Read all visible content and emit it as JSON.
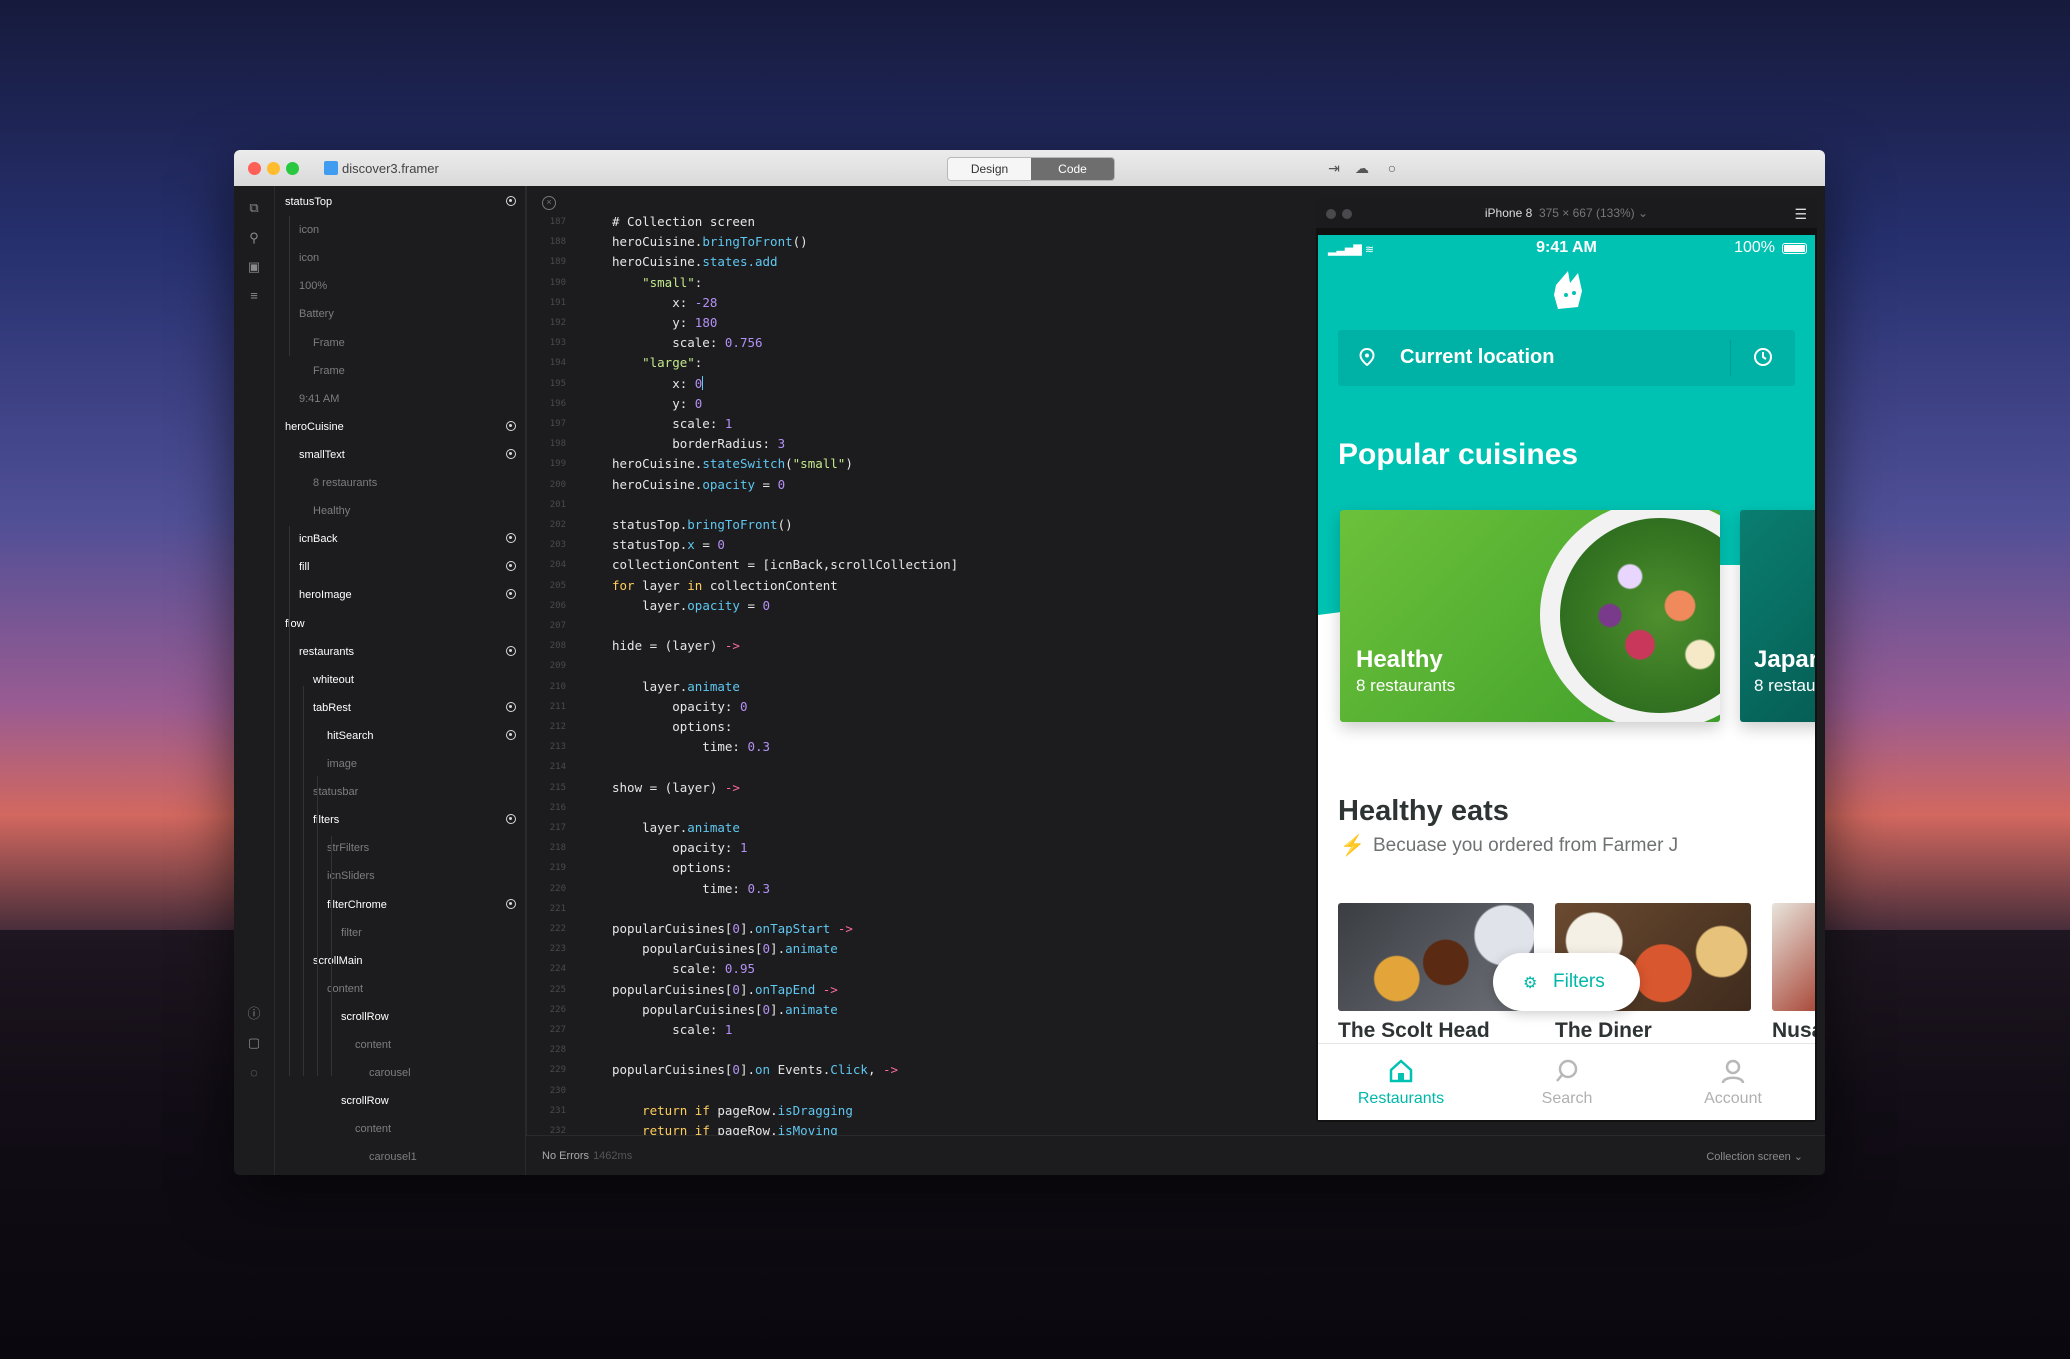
{
  "window": {
    "project_name": "discover3.framer",
    "mode_tabs": [
      "Design",
      "Code"
    ],
    "active_mode": "Code"
  },
  "layers": [
    {
      "name": "statusTop",
      "depth": 0,
      "bold": true,
      "dot": true
    },
    {
      "name": "icon",
      "depth": 1,
      "bold": false,
      "dot": false
    },
    {
      "name": "icon",
      "depth": 1,
      "bold": false,
      "dot": false
    },
    {
      "name": "100%",
      "depth": 1,
      "bold": false,
      "dot": false
    },
    {
      "name": "Battery",
      "depth": 1,
      "bold": false,
      "dot": false
    },
    {
      "name": "Frame",
      "depth": 2,
      "bold": false,
      "dot": false
    },
    {
      "name": "Frame",
      "depth": 2,
      "bold": false,
      "dot": false
    },
    {
      "name": "9:41 AM",
      "depth": 1,
      "bold": false,
      "dot": false
    },
    {
      "name": "heroCuisine",
      "depth": 0,
      "bold": true,
      "dot": true
    },
    {
      "name": "smallText",
      "depth": 1,
      "bold": true,
      "dot": true
    },
    {
      "name": "8 restaurants",
      "depth": 2,
      "bold": false,
      "dot": false
    },
    {
      "name": "Healthy",
      "depth": 2,
      "bold": false,
      "dot": false
    },
    {
      "name": "icnBack",
      "depth": 1,
      "bold": true,
      "dot": true
    },
    {
      "name": "fill",
      "depth": 1,
      "bold": true,
      "dot": true
    },
    {
      "name": "heroImage",
      "depth": 1,
      "bold": true,
      "dot": true
    },
    {
      "name": "flow",
      "depth": 0,
      "bold": true,
      "dot": false
    },
    {
      "name": "restaurants",
      "depth": 1,
      "bold": true,
      "dot": true
    },
    {
      "name": "whiteout",
      "depth": 2,
      "bold": true,
      "dot": false
    },
    {
      "name": "tabRest",
      "depth": 2,
      "bold": true,
      "dot": true
    },
    {
      "name": "hitSearch",
      "depth": 3,
      "bold": true,
      "dot": true
    },
    {
      "name": "image",
      "depth": 3,
      "bold": false,
      "dot": false
    },
    {
      "name": "statusbar",
      "depth": 2,
      "bold": false,
      "dot": false
    },
    {
      "name": "filters",
      "depth": 2,
      "bold": true,
      "dot": true
    },
    {
      "name": "strFilters",
      "depth": 3,
      "bold": false,
      "dot": false
    },
    {
      "name": "icnSliders",
      "depth": 3,
      "bold": false,
      "dot": false
    },
    {
      "name": "filterChrome",
      "depth": 3,
      "bold": true,
      "dot": true
    },
    {
      "name": "filter",
      "depth": 4,
      "bold": false,
      "dot": false
    },
    {
      "name": "scrollMain",
      "depth": 2,
      "bold": true,
      "dot": false
    },
    {
      "name": "content",
      "depth": 3,
      "bold": false,
      "dot": false
    },
    {
      "name": "scrollRow",
      "depth": 4,
      "bold": true,
      "dot": false
    },
    {
      "name": "content",
      "depth": 5,
      "bold": false,
      "dot": false
    },
    {
      "name": "carousel",
      "depth": 6,
      "bold": false,
      "dot": false
    },
    {
      "name": "scrollRow",
      "depth": 4,
      "bold": true,
      "dot": false
    },
    {
      "name": "content",
      "depth": 5,
      "bold": false,
      "dot": false
    },
    {
      "name": "carousel1",
      "depth": 6,
      "bold": false,
      "dot": false
    }
  ],
  "code": {
    "header_comment": "# Collection screen",
    "lines": [
      {
        "n": "187",
        "t": []
      },
      {
        "n": "188",
        "t": [
          [
            "heroCuisine.",
            ""
          ],
          [
            "bringToFront",
            "prop"
          ],
          [
            "()",
            ""
          ]
        ]
      },
      {
        "n": "189",
        "t": [
          [
            "heroCuisine.",
            ""
          ],
          [
            "states.add",
            "prop"
          ]
        ]
      },
      {
        "n": "190",
        "t": [
          [
            "    ",
            ""
          ],
          [
            "\"small\"",
            "str"
          ],
          [
            ":",
            ""
          ]
        ]
      },
      {
        "n": "191",
        "t": [
          [
            "        x: ",
            ""
          ],
          [
            "-28",
            "num"
          ]
        ]
      },
      {
        "n": "192",
        "t": [
          [
            "        y: ",
            ""
          ],
          [
            "180",
            "num"
          ]
        ]
      },
      {
        "n": "193",
        "t": [
          [
            "        scale: ",
            ""
          ],
          [
            "0.756",
            "num"
          ]
        ]
      },
      {
        "n": "194",
        "t": [
          [
            "    ",
            ""
          ],
          [
            "\"large\"",
            "str"
          ],
          [
            ":",
            ""
          ]
        ]
      },
      {
        "n": "195",
        "t": [
          [
            "        x: ",
            ""
          ],
          [
            "0",
            "num"
          ],
          [
            "|",
            "cursor"
          ]
        ]
      },
      {
        "n": "196",
        "t": [
          [
            "        y: ",
            ""
          ],
          [
            "0",
            "num"
          ]
        ]
      },
      {
        "n": "197",
        "t": [
          [
            "        scale: ",
            ""
          ],
          [
            "1",
            "num"
          ]
        ]
      },
      {
        "n": "198",
        "t": [
          [
            "        borderRadius: ",
            ""
          ],
          [
            "3",
            "num"
          ]
        ]
      },
      {
        "n": "199",
        "t": [
          [
            "heroCuisine.",
            ""
          ],
          [
            "stateSwitch",
            "prop"
          ],
          [
            "(",
            ""
          ],
          [
            "\"small\"",
            "str"
          ],
          [
            ")",
            ""
          ]
        ]
      },
      {
        "n": "200",
        "t": [
          [
            "heroCuisine.",
            ""
          ],
          [
            "opacity",
            "prop"
          ],
          [
            " = ",
            ""
          ],
          [
            "0",
            "num"
          ]
        ]
      },
      {
        "n": "201",
        "t": []
      },
      {
        "n": "202",
        "t": [
          [
            "statusTop.",
            ""
          ],
          [
            "bringToFront",
            "prop"
          ],
          [
            "()",
            ""
          ]
        ]
      },
      {
        "n": "203",
        "t": [
          [
            "statusTop.",
            ""
          ],
          [
            "x",
            "prop"
          ],
          [
            " = ",
            ""
          ],
          [
            "0",
            "num"
          ]
        ]
      },
      {
        "n": "204",
        "t": [
          [
            "collectionContent = [icnBack,scrollCollection]",
            ""
          ]
        ]
      },
      {
        "n": "205",
        "t": [
          [
            "for",
            "kw"
          ],
          [
            " layer ",
            ""
          ],
          [
            "in",
            "kw"
          ],
          [
            " collectionContent",
            ""
          ]
        ]
      },
      {
        "n": "206",
        "t": [
          [
            "    layer.",
            ""
          ],
          [
            "opacity",
            "prop"
          ],
          [
            " = ",
            ""
          ],
          [
            "0",
            "num"
          ]
        ]
      },
      {
        "n": "207",
        "t": []
      },
      {
        "n": "208",
        "t": [
          [
            "hide = (layer) ",
            ""
          ],
          [
            "->",
            "arrow"
          ]
        ]
      },
      {
        "n": "209",
        "t": []
      },
      {
        "n": "210",
        "t": [
          [
            "    layer.",
            ""
          ],
          [
            "animate",
            "prop"
          ]
        ]
      },
      {
        "n": "211",
        "t": [
          [
            "        opacity: ",
            ""
          ],
          [
            "0",
            "num"
          ]
        ]
      },
      {
        "n": "212",
        "t": [
          [
            "        options:",
            ""
          ]
        ]
      },
      {
        "n": "213",
        "t": [
          [
            "            time: ",
            ""
          ],
          [
            "0.3",
            "num"
          ]
        ]
      },
      {
        "n": "214",
        "t": []
      },
      {
        "n": "215",
        "t": [
          [
            "show = (layer) ",
            ""
          ],
          [
            "->",
            "arrow"
          ]
        ]
      },
      {
        "n": "216",
        "t": []
      },
      {
        "n": "217",
        "t": [
          [
            "    layer.",
            ""
          ],
          [
            "animate",
            "prop"
          ]
        ]
      },
      {
        "n": "218",
        "t": [
          [
            "        opacity: ",
            ""
          ],
          [
            "1",
            "num"
          ]
        ]
      },
      {
        "n": "219",
        "t": [
          [
            "        options:",
            ""
          ]
        ]
      },
      {
        "n": "220",
        "t": [
          [
            "            time: ",
            ""
          ],
          [
            "0.3",
            "num"
          ]
        ]
      },
      {
        "n": "221",
        "t": []
      },
      {
        "n": "222",
        "t": [
          [
            "popularCuisines[",
            ""
          ],
          [
            "0",
            "num"
          ],
          [
            "].",
            ""
          ],
          [
            "onTapStart",
            "prop"
          ],
          [
            " ",
            ""
          ],
          [
            "->",
            "arrow"
          ]
        ]
      },
      {
        "n": "223",
        "t": [
          [
            "    popularCuisines[",
            ""
          ],
          [
            "0",
            "num"
          ],
          [
            "].",
            ""
          ],
          [
            "animate",
            "prop"
          ]
        ]
      },
      {
        "n": "224",
        "t": [
          [
            "        scale: ",
            ""
          ],
          [
            "0.95",
            "num"
          ]
        ]
      },
      {
        "n": "225",
        "t": [
          [
            "popularCuisines[",
            ""
          ],
          [
            "0",
            "num"
          ],
          [
            "].",
            ""
          ],
          [
            "onTapEnd",
            "prop"
          ],
          [
            " ",
            ""
          ],
          [
            "->",
            "arrow"
          ]
        ]
      },
      {
        "n": "226",
        "t": [
          [
            "    popularCuisines[",
            ""
          ],
          [
            "0",
            "num"
          ],
          [
            "].",
            ""
          ],
          [
            "animate",
            "prop"
          ]
        ]
      },
      {
        "n": "227",
        "t": [
          [
            "        scale: ",
            ""
          ],
          [
            "1",
            "num"
          ]
        ]
      },
      {
        "n": "228",
        "t": []
      },
      {
        "n": "229",
        "t": [
          [
            "popularCuisines[",
            ""
          ],
          [
            "0",
            "num"
          ],
          [
            "].",
            ""
          ],
          [
            "on",
            "prop"
          ],
          [
            " Events.",
            ""
          ],
          [
            "Click",
            "prop"
          ],
          [
            ", ",
            ""
          ],
          [
            "->",
            "arrow"
          ]
        ]
      },
      {
        "n": "230",
        "t": []
      },
      {
        "n": "231",
        "t": [
          [
            "    ",
            ""
          ],
          [
            "return",
            "kw"
          ],
          [
            " ",
            ""
          ],
          [
            "if",
            "kw"
          ],
          [
            " pageRow.",
            ""
          ],
          [
            "isDragging",
            "prop"
          ]
        ]
      },
      {
        "n": "232",
        "t": [
          [
            "    ",
            ""
          ],
          [
            "return",
            "kw"
          ],
          [
            " ",
            ""
          ],
          [
            "if",
            "kw"
          ],
          [
            " pageRow.",
            ""
          ],
          [
            "isMoving",
            "prop"
          ]
        ]
      }
    ]
  },
  "statusbar": {
    "errors": "No Errors",
    "compile_time": "1462ms",
    "screen": "Collection screen"
  },
  "device": {
    "name": "iPhone 8",
    "spec": "375 × 667 (133%)"
  },
  "app": {
    "status_time": "9:41 AM",
    "battery_text": "100%",
    "location_label": "Current location",
    "popular_title": "Popular cuisines",
    "cuisines": [
      {
        "title": "Healthy",
        "subtitle": "8 restaurants"
      },
      {
        "title": "Japar",
        "subtitle": "8 restau"
      }
    ],
    "healthy_title": "Healthy eats",
    "healthy_subtitle": "Becuase you ordered from Farmer J",
    "restaurants": [
      "The Scolt Head",
      "The Diner",
      "Nusa"
    ],
    "filters_label": "Filters",
    "tabs": [
      {
        "label": "Restaurants",
        "active": true
      },
      {
        "label": "Search",
        "active": false
      },
      {
        "label": "Account",
        "active": false
      }
    ],
    "accent": "#00c2b3"
  }
}
